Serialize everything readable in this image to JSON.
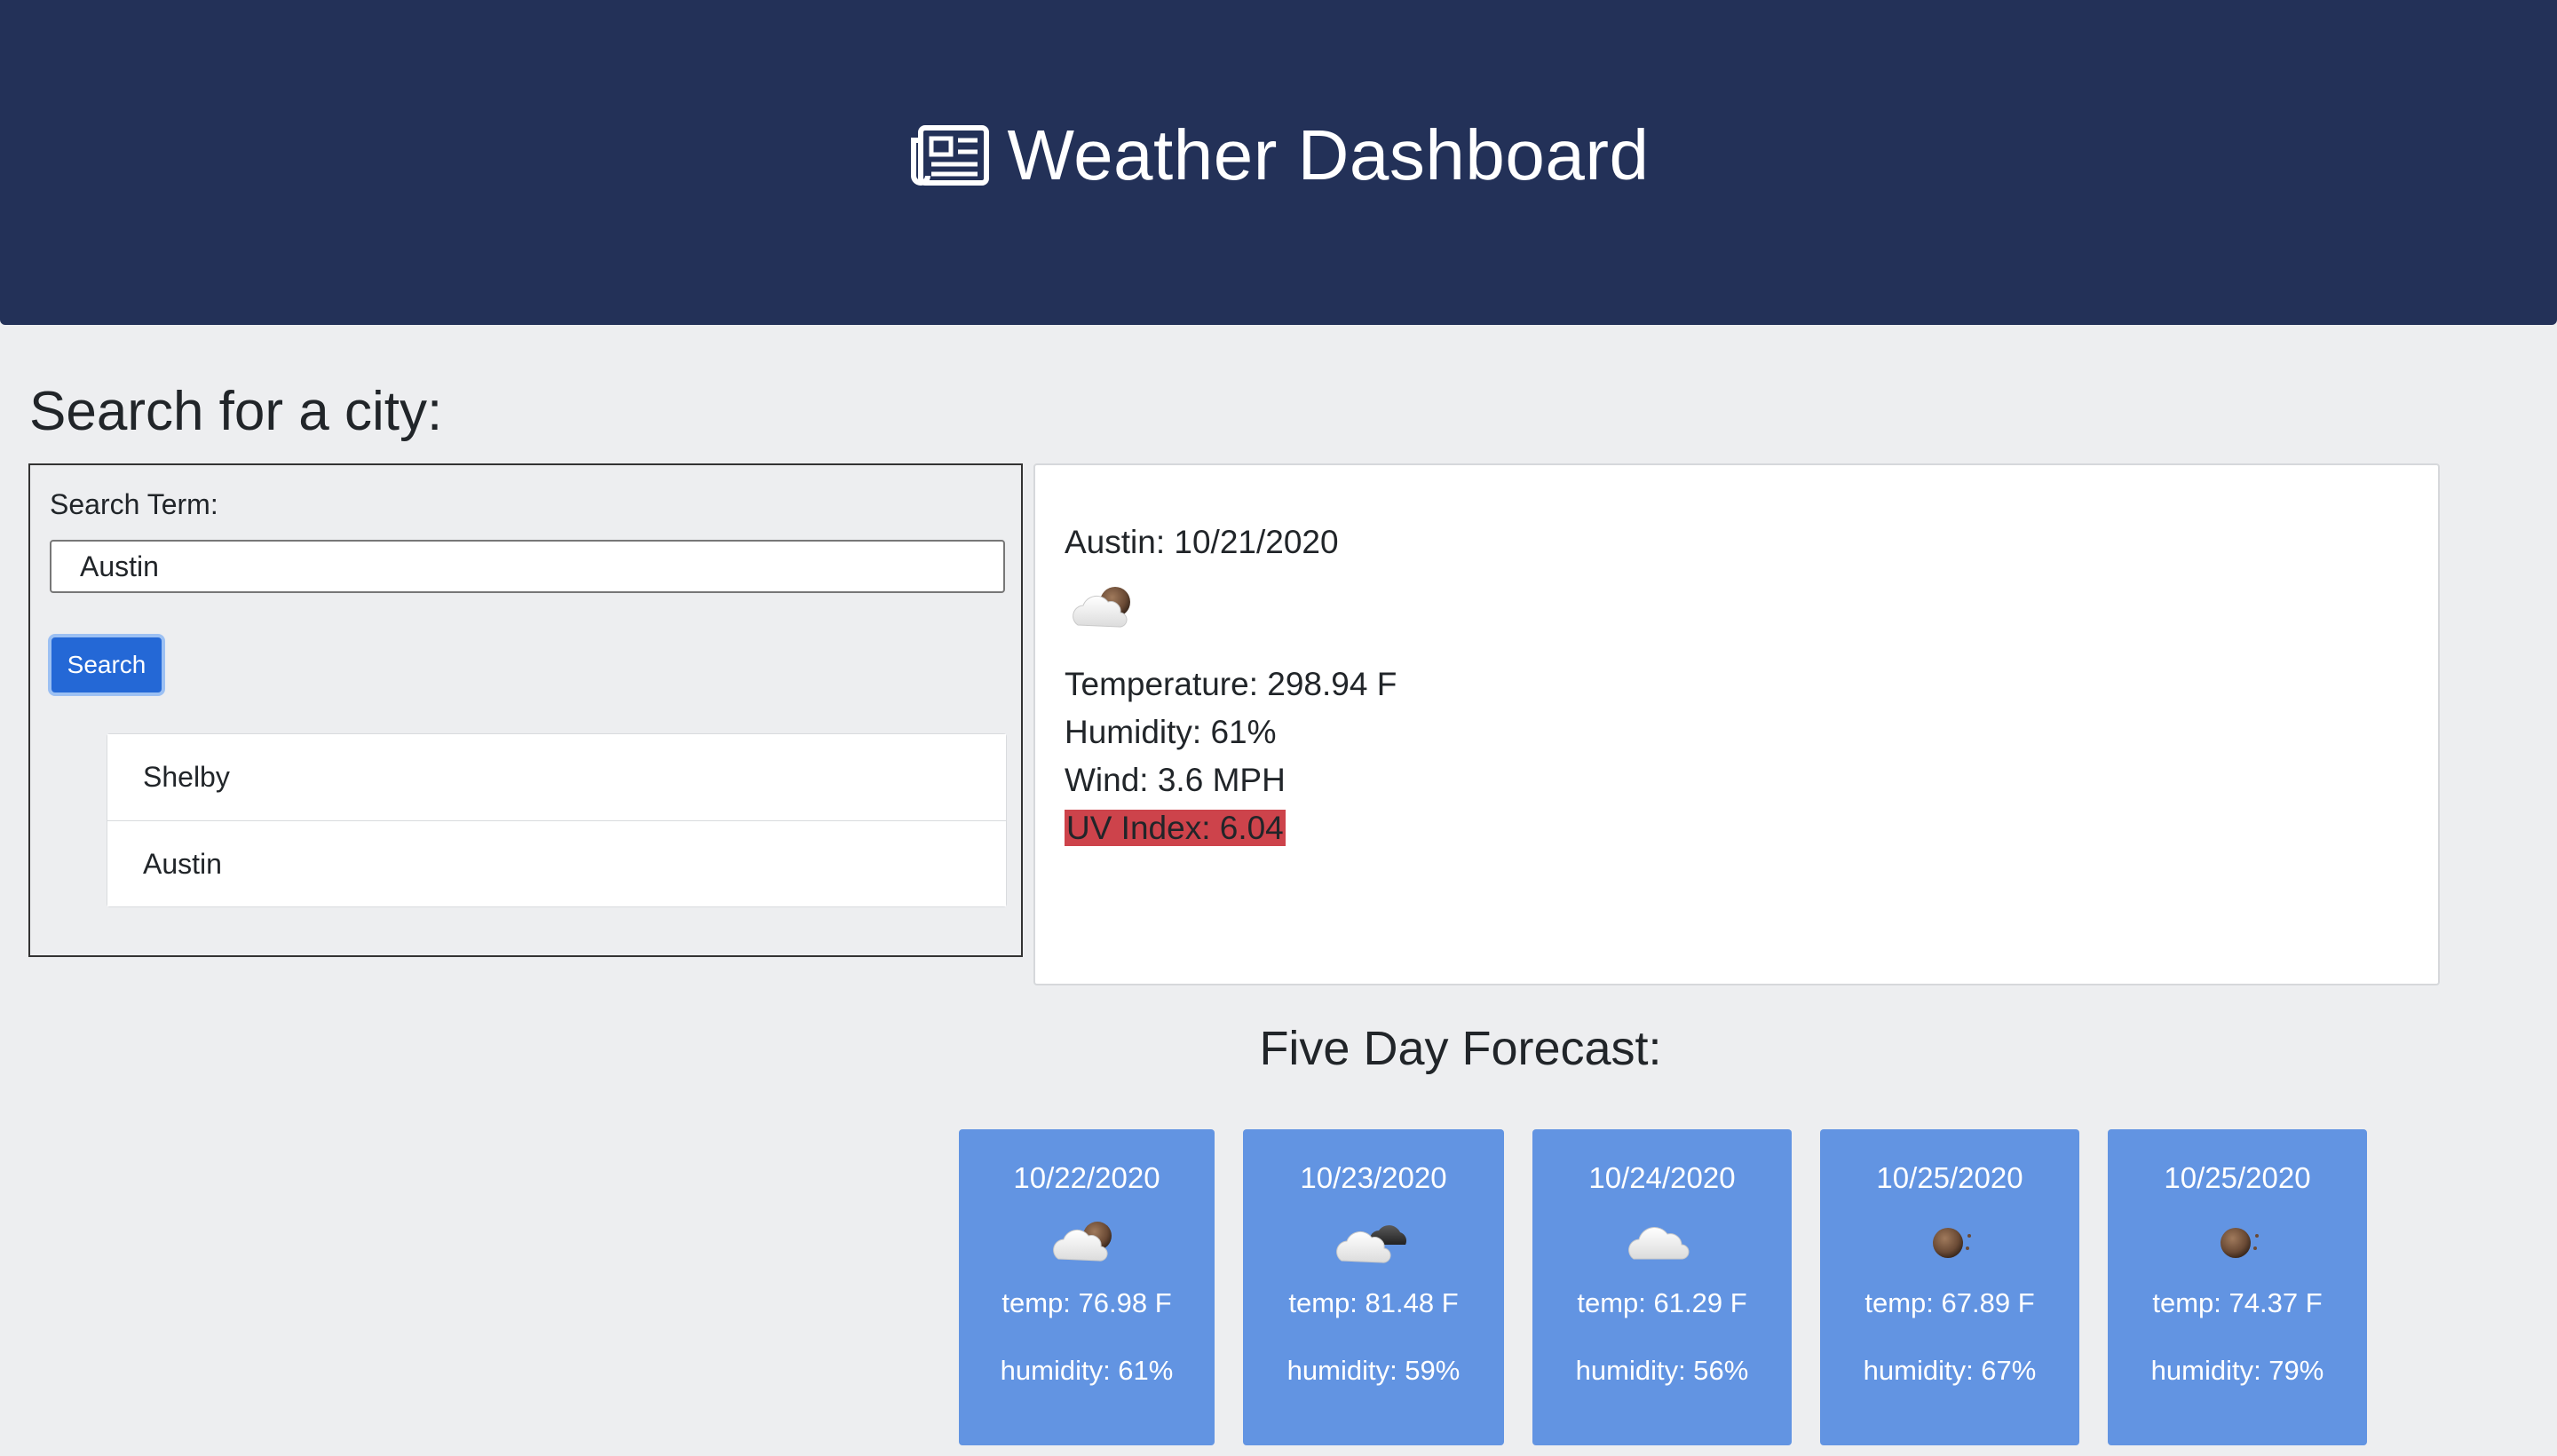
{
  "header": {
    "title": "Weather Dashboard",
    "icon": "newspaper-icon"
  },
  "search": {
    "heading": "Search for a city:",
    "label": "Search Term:",
    "input_value": "Austin",
    "button_label": "Search",
    "history": [
      {
        "label": "Shelby"
      },
      {
        "label": "Austin"
      }
    ]
  },
  "current": {
    "city_date": "Austin: 10/21/2020",
    "icon": "partly-cloudy-night-icon",
    "temperature": "Temperature: 298.94 F",
    "humidity": "Humidity: 61%",
    "wind": "Wind: 3.6 MPH",
    "uv": "UV Index: 6.04",
    "uv_color": "#cd434b"
  },
  "forecast": {
    "heading": "Five Day Forecast:",
    "card_color": "#6294e2",
    "days": [
      {
        "date": "10/22/2020",
        "icon": "partly-cloudy-night-icon",
        "temp": "temp: 76.98 F",
        "humidity": "humidity: 61%"
      },
      {
        "date": "10/23/2020",
        "icon": "cloudy-night-icon",
        "temp": "temp: 81.48 F",
        "humidity": "humidity: 59%"
      },
      {
        "date": "10/24/2020",
        "icon": "cloud-icon",
        "temp": "temp: 61.29 F",
        "humidity": "humidity: 56%"
      },
      {
        "date": "10/25/2020",
        "icon": "clear-night-icon",
        "temp": "temp: 67.89 F",
        "humidity": "humidity: 67%"
      },
      {
        "date": "10/25/2020",
        "icon": "clear-night-icon",
        "temp": "temp: 74.37 F",
        "humidity": "humidity: 79%"
      }
    ]
  }
}
